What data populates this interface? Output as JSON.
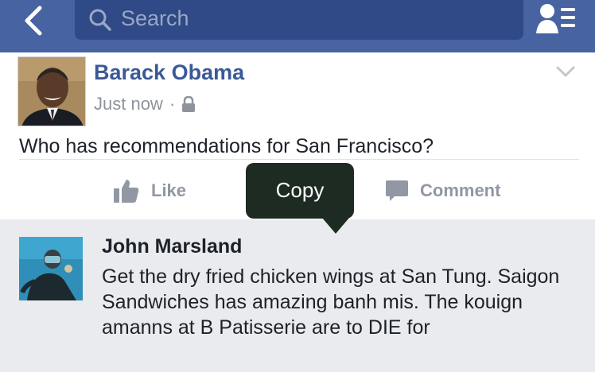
{
  "navbar": {
    "search_placeholder": "Search",
    "back_icon": "chevron-left-icon",
    "friends_icon": "friends-list-icon",
    "bar_color": "#4763a2"
  },
  "post": {
    "author": "Barack Obama",
    "timestamp": "Just now",
    "separator": "·",
    "privacy_icon": "lock-icon",
    "text": "Who has recommendations for San Francisco?",
    "like_label": "Like",
    "comment_label": "Comment"
  },
  "tooltip": {
    "label": "Copy"
  },
  "comment": {
    "author": "John Marsland",
    "text": "Get the dry fried chicken wings at San Tung. Saigon Sandwiches has amazing banh mis. The kouign amanns at B Patisserie are to DIE for"
  },
  "colors": {
    "link_blue": "#3b5998",
    "muted_gray": "#9197a3",
    "comment_bg": "#e9ebee",
    "tooltip_bg": "#1e2b22"
  }
}
